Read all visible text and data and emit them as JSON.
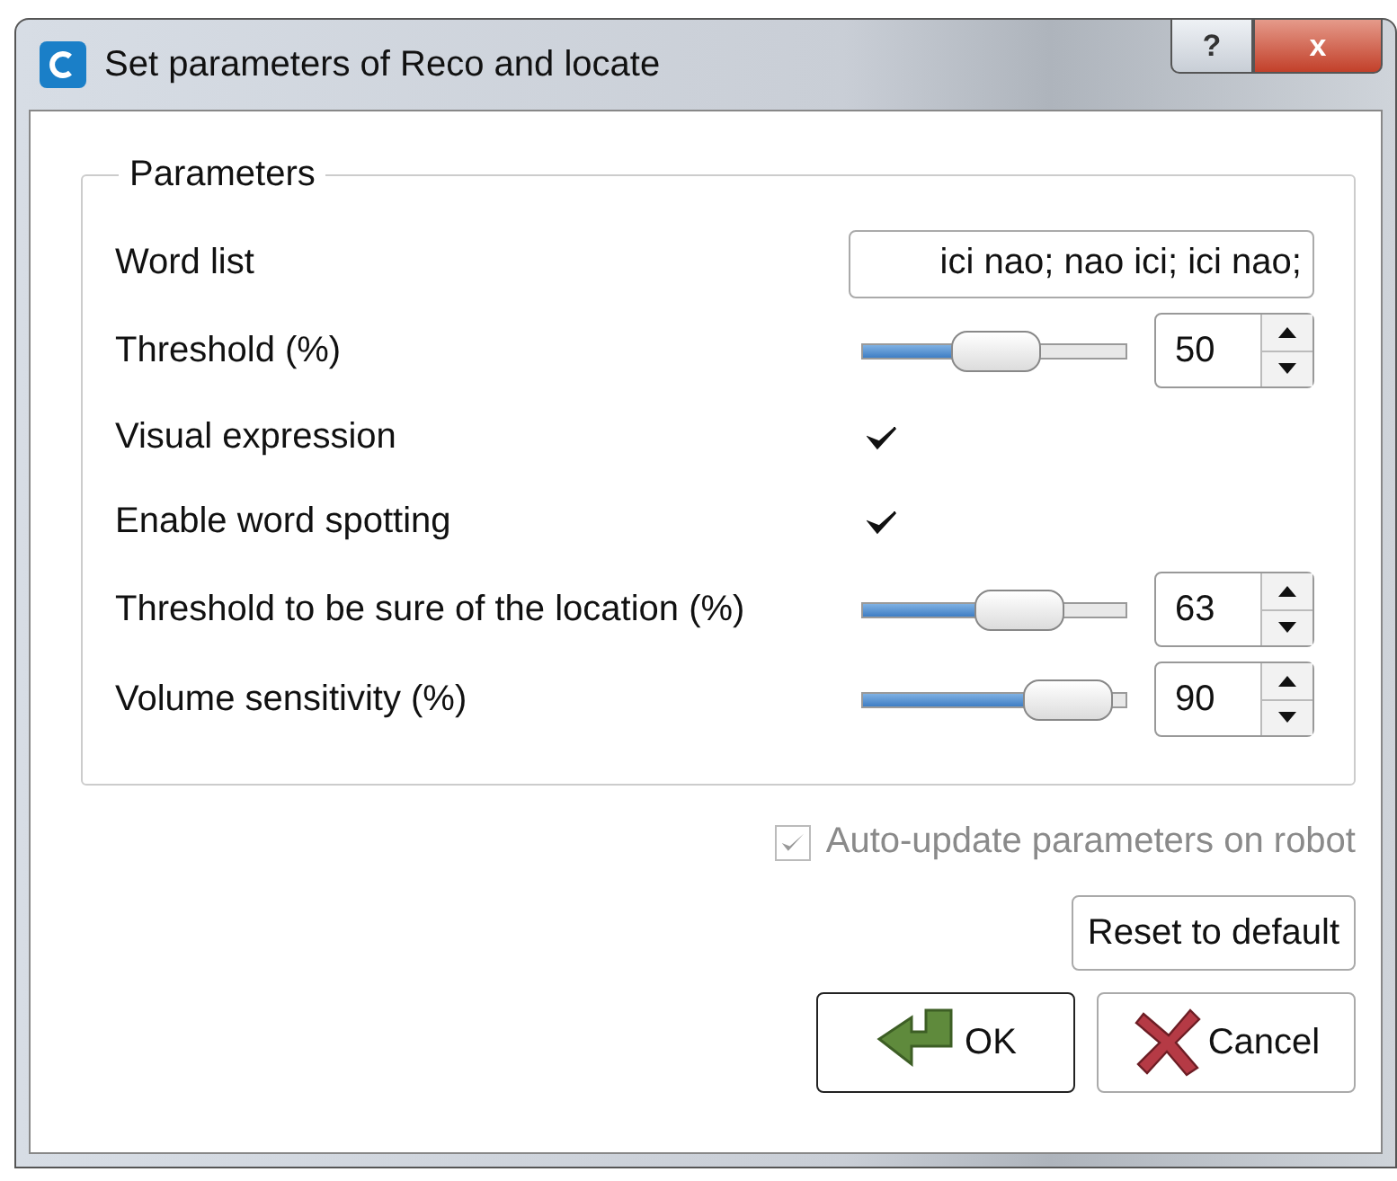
{
  "window": {
    "title": "Set parameters of Reco and locate",
    "help_button": "?",
    "close_button": "x"
  },
  "group": {
    "title": "Parameters",
    "rows": [
      {
        "kind": "text",
        "label": "Word list",
        "value": "ici nao; nao ici; ici nao;"
      },
      {
        "kind": "slider",
        "label": "Threshold (%)",
        "level": 0.5,
        "value": "50"
      },
      {
        "kind": "checkbox",
        "label": "Visual expression",
        "checked": true
      },
      {
        "kind": "checkbox",
        "label": "Enable word spotting",
        "checked": true
      },
      {
        "kind": "slider",
        "label": "Threshold to be sure of the location (%)",
        "level": 0.63,
        "value": "63"
      },
      {
        "kind": "slider",
        "label": "Volume sensitivity (%)",
        "level": 0.9,
        "value": "90"
      }
    ]
  },
  "auto_update": {
    "label": "Auto-update parameters on robot",
    "checked": true,
    "disabled": true
  },
  "buttons": {
    "reset": "Reset to default",
    "ok": "OK",
    "cancel": "Cancel"
  }
}
